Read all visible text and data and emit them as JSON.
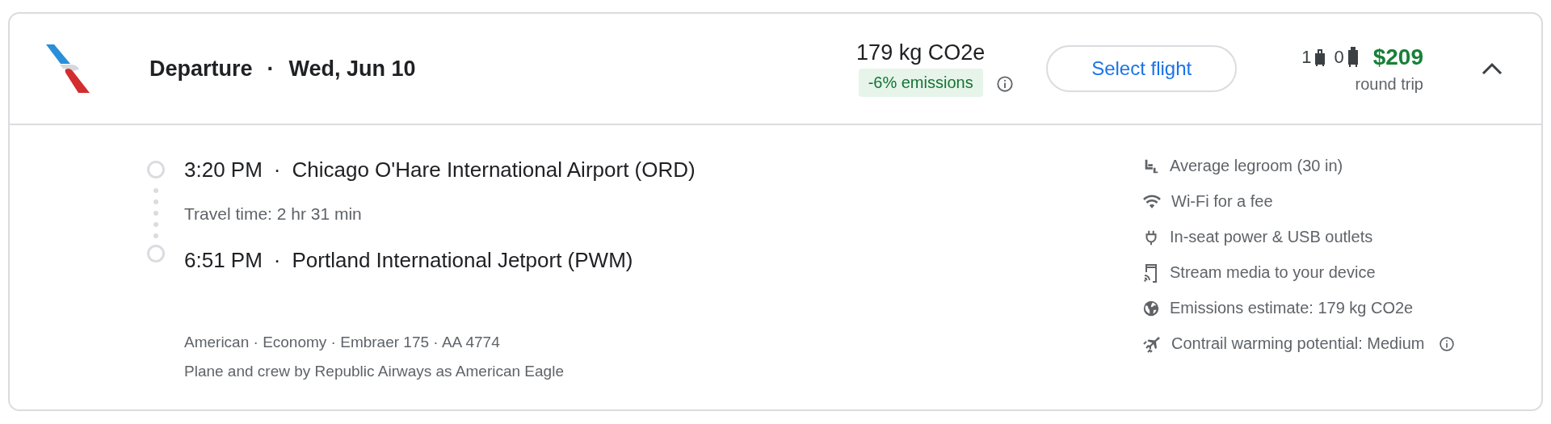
{
  "header": {
    "title": "Departure",
    "separator": "·",
    "date": "Wed, Jun 10",
    "emissions": "179 kg CO2e",
    "emissions_badge": "-6% emissions",
    "button": "Select flight",
    "carry_on": "1",
    "checked_bags": "0",
    "price": "$209",
    "price_note": "round trip",
    "expanded": true
  },
  "itinerary": {
    "departure": {
      "time": "3:20 PM",
      "separator": "·",
      "airport": "Chicago O'Hare International Airport (ORD)"
    },
    "travel_time": "Travel time: 2 hr 31 min",
    "arrival": {
      "time": "6:51 PM",
      "separator": "·",
      "airport": "Portland International Jetport (PWM)"
    },
    "details": "American · Economy · Embraer 175 · AA 4774",
    "operator": "Plane and crew by Republic Airways as American Eagle"
  },
  "amenities": [
    {
      "kind": "legroom",
      "label": "Average legroom (30 in)",
      "info": false
    },
    {
      "kind": "wifi",
      "label": "Wi-Fi for a fee",
      "info": false
    },
    {
      "kind": "power",
      "label": "In-seat power & USB outlets",
      "info": false
    },
    {
      "kind": "stream",
      "label": "Stream media to your device",
      "info": false
    },
    {
      "kind": "emissions",
      "label": "Emissions estimate: 179 kg CO2e",
      "info": false
    },
    {
      "kind": "contrail",
      "label": "Contrail warming potential: Medium",
      "info": true
    }
  ]
}
